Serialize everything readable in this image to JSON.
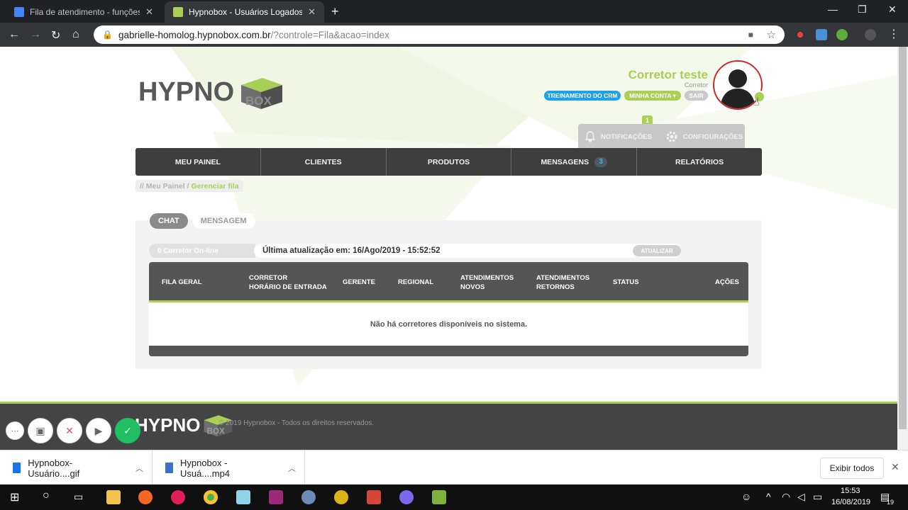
{
  "browser": {
    "tabs": [
      {
        "title": "Fila de atendimento - funções m",
        "active": false
      },
      {
        "title": "Hypnobox - Usuários Logados",
        "active": true
      }
    ],
    "url_host": "gabrielle-homolog.hypnobox.com.br",
    "url_path": "/?controle=Fila&acao=index"
  },
  "header": {
    "logo_text_left": "HYPNO",
    "logo_text_right": "BOX",
    "user_name": "Corretor teste",
    "user_role": "Corretor",
    "links": {
      "training": "TREINAMENTO DO CRM",
      "account": "MINHA CONTA ▾",
      "logout": "SAIR"
    },
    "notif_count": "1",
    "notifications_label": "NOTIFICAÇÕES",
    "settings_label": "CONFIGURAÇÕES"
  },
  "nav": {
    "items": [
      "MEU PAINEL",
      "CLIENTES",
      "PRODUTOS",
      "MENSAGENS",
      "RELATÓRIOS"
    ],
    "messages_badge": "3"
  },
  "breadcrumb": {
    "root": "// Meu Painel /",
    "current": "Gerenciar fila"
  },
  "tabs": {
    "chat": "CHAT",
    "message": "MENSAGEM"
  },
  "status": {
    "online": "0 Corretor On-line",
    "last_update": "Última atualização em: 16/Ago/2019 - 15:52:52",
    "refresh": "ATUALIZAR"
  },
  "table": {
    "headers": [
      {
        "line1": "FILA GERAL",
        "line2": ""
      },
      {
        "line1": "CORRETOR",
        "line2": "HORÁRIO DE ENTRADA"
      },
      {
        "line1": "GERENTE",
        "line2": ""
      },
      {
        "line1": "REGIONAL",
        "line2": ""
      },
      {
        "line1": "ATENDIMENTOS",
        "line2": "NOVOS"
      },
      {
        "line1": "ATENDIMENTOS",
        "line2": "RETORNOS"
      },
      {
        "line1": "STATUS",
        "line2": ""
      },
      {
        "line1": "AÇÕES",
        "line2": ""
      }
    ],
    "empty_message": "Não há corretores disponíveis no sistema."
  },
  "footer": {
    "copyright": "© 2019 Hypnobox - Todos os direitos reservados."
  },
  "downloads": {
    "items": [
      "Hypnobox-Usuário....gif",
      "Hypnobox - Usuá....mp4"
    ],
    "show_all": "Exibir todos"
  },
  "taskbar": {
    "time": "15:53",
    "date": "16/08/2019",
    "notif_count": "19"
  },
  "colors": {
    "brand_green": "#a9cf54",
    "nav_dark": "#3e3e3e",
    "training_blue": "#1ea1e6",
    "avatar_ring": "#d02a2a"
  }
}
